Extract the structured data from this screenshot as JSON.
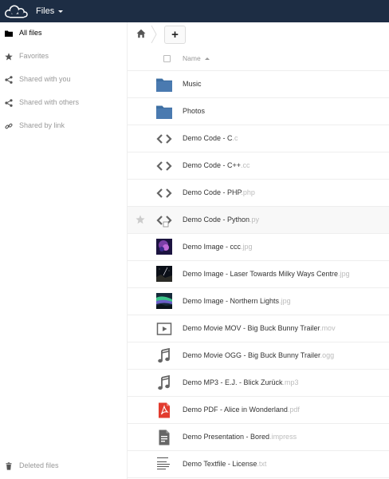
{
  "header": {
    "app_title": "Files",
    "colors": {
      "bg": "#1d2d44",
      "text": "#ffffff"
    }
  },
  "sidebar": {
    "items": [
      {
        "label": "All files",
        "icon": "folder-icon",
        "active": true
      },
      {
        "label": "Favorites",
        "icon": "star-icon",
        "active": false
      },
      {
        "label": "Shared with you",
        "icon": "share-icon",
        "active": false
      },
      {
        "label": "Shared with others",
        "icon": "share-icon",
        "active": false
      },
      {
        "label": "Shared by link",
        "icon": "link-icon",
        "active": false
      }
    ],
    "trash": {
      "label": "Deleted files",
      "icon": "trash-icon"
    }
  },
  "controls": {
    "add_label": "+"
  },
  "table": {
    "name_header": "Name",
    "sort": "ascending",
    "rows": [
      {
        "name": "Music",
        "ext": "",
        "type": "folder"
      },
      {
        "name": "Photos",
        "ext": "",
        "type": "folder"
      },
      {
        "name": "Demo Code - C",
        "ext": ".c",
        "type": "code"
      },
      {
        "name": "Demo Code - C++",
        "ext": ".cc",
        "type": "code"
      },
      {
        "name": "Demo Code - PHP",
        "ext": ".php",
        "type": "code"
      },
      {
        "name": "Demo Code - Python",
        "ext": ".py",
        "type": "code"
      },
      {
        "name": "Demo Image - ccc",
        "ext": ".jpg",
        "type": "image"
      },
      {
        "name": "Demo Image - Laser Towards Milky Ways Centre",
        "ext": ".jpg",
        "type": "image"
      },
      {
        "name": "Demo Image - Northern Lights",
        "ext": ".jpg",
        "type": "image"
      },
      {
        "name": "Demo Movie MOV - Big Buck Bunny Trailer",
        "ext": ".mov",
        "type": "video"
      },
      {
        "name": "Demo Movie OGG - Big Buck Bunny Trailer",
        "ext": ".ogg",
        "type": "audio"
      },
      {
        "name": "Demo MP3 - E.J. - Blick Zurück",
        "ext": ".mp3",
        "type": "audio"
      },
      {
        "name": "Demo PDF - Alice in Wonderland",
        "ext": ".pdf",
        "type": "pdf"
      },
      {
        "name": "Demo Presentation - Bored",
        "ext": ".impress",
        "type": "document"
      },
      {
        "name": "Demo Textfile - License",
        "ext": ".txt",
        "type": "text"
      }
    ]
  }
}
